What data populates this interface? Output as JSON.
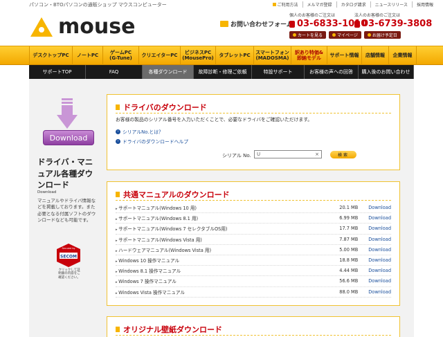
{
  "header": {
    "tagline": "パソコン・BTOパソコンの通販ショップ マウスコンピューター",
    "toplinks": [
      "ご利用方法",
      "メルマガ登録",
      "カタログ請求",
      "ニュースリリース",
      "採用情報"
    ],
    "logo_text": "mouse",
    "contact": "お問い合わせフォーム",
    "personal_label": "個人のお客様のご注文は",
    "personal_tel": "03-6833-1010",
    "corporate_label": "法人のお客様のご注文は",
    "corporate_tel": "03-6739-3808",
    "buttons": [
      "カートを見る",
      "マイページ",
      "お届け予定日"
    ]
  },
  "mainnav": [
    {
      "label": "デスクトップPC",
      "w": 63
    },
    {
      "label": "ノートPC",
      "w": 44
    },
    {
      "label": "ゲームPC\n(G-Tune)",
      "w": 52
    },
    {
      "label": "クリエイターPC",
      "w": 60
    },
    {
      "label": "ビジネスPC\n(MousePro)",
      "w": 51
    },
    {
      "label": "タブレットPC",
      "w": 55
    },
    {
      "label": "スマートフォン\n(MADOSMA)",
      "w": 54
    },
    {
      "label": "訳あり特価&\n即納モデル",
      "w": 52,
      "red": true
    },
    {
      "label": "サポート情報",
      "w": 50
    },
    {
      "label": "店舗情報",
      "w": 39
    },
    {
      "label": "企業情報",
      "w": 40
    }
  ],
  "subnav": [
    {
      "label": "サポートTOP",
      "w": 82
    },
    {
      "label": "FAQ",
      "w": 82
    },
    {
      "label": "各種ダウンロード",
      "w": 74,
      "active": true
    },
    {
      "label": "故障診断・修理ご依頼",
      "w": 84
    },
    {
      "label": "特設サポート",
      "w": 76
    },
    {
      "label": "お客様の声への回答",
      "w": 78
    },
    {
      "label": "購入後のお問い合わせ",
      "w": 80
    }
  ],
  "sidebar": {
    "download_button": "Download",
    "title": "ドライバ・マニュアル各種ダウンロード",
    "subtitle_en": "Download",
    "description": "マニュアルやドライバ情報などを掲載しております。また 必要となる付属ソフトのダウンロードなども可能です。",
    "secom_top": "Secured by",
    "secom_logo": "SECOM",
    "secom_caption": "クリックして証明書の内容をご確認ください。"
  },
  "driver_panel": {
    "title": "ドライバのダウンロード",
    "intro": "お客様の製品のシリアル番号を入力いただくことで、必要なドライバをご確認いただけます。",
    "link1": "シリアルNo.とは？",
    "link2": "ドライバのダウンロードヘルプ",
    "serial_label": "シリアル No.",
    "serial_value": "U",
    "search_button": "検索"
  },
  "manual_panel": {
    "title": "共通マニュアルのダウンロード",
    "rows": [
      {
        "name": "サポートマニュアル(Windows 10 用)",
        "size": "20.1 MB",
        "link": "Download"
      },
      {
        "name": "サポートマニュアル(Windows 8.1 用)",
        "size": "6.99 MB",
        "link": "Download"
      },
      {
        "name": "サポートマニュアル(Windows 7 セレクタブルOS用)",
        "size": "17.7 MB",
        "link": "Download"
      },
      {
        "name": "サポートマニュアル(Windows Vista 用)",
        "size": "7.87 MB",
        "link": "Download"
      },
      {
        "name": "ハードウェアマニュアル(Windows Vista 用)",
        "size": "5.00 MB",
        "link": "Download"
      },
      {
        "name": "Windows 10 操作マニュアル",
        "size": "18.8 MB",
        "link": "Download"
      },
      {
        "name": "Windows 8.1 操作マニュアル",
        "size": "4.44 MB",
        "link": "Download"
      },
      {
        "name": "Windows 7 操作マニュアル",
        "size": "56.6 MB",
        "link": "Download"
      },
      {
        "name": "Windows Vista 操作マニュアル",
        "size": "88.0 MB",
        "link": "Download"
      }
    ]
  },
  "wallpaper_panel": {
    "title": "オリジナル壁紙ダウンロード"
  }
}
